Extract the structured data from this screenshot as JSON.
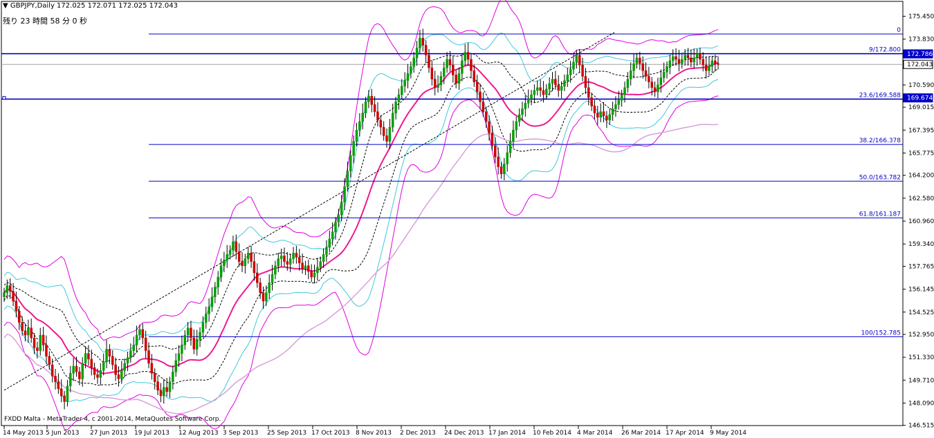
{
  "header": {
    "symbol_line": "GBPJPY,Daily  172.025 172.071 172.025 172.043",
    "countdown": "残り 23 時間 58 分 0 秒",
    "copyright": "FXDD Malta - MetaTrader 4, c 2001-2014, MetaQuotes Software Corp."
  },
  "chart_data": {
    "type": "candlestick",
    "symbol": "GBPJPY",
    "timeframe": "Daily",
    "last_bar": {
      "open": 172.025,
      "high": 172.071,
      "low": 172.025,
      "close": 172.043
    },
    "ylim": [
      146.5,
      176.5
    ],
    "y_ticks": [
      "175.450",
      "173.830",
      "172.786",
      "172.043",
      "170.590",
      "169.674",
      "169.015",
      "167.395",
      "165.775",
      "164.200",
      "162.580",
      "160.960",
      "159.340",
      "157.765",
      "156.145",
      "154.525",
      "152.950",
      "151.330",
      "149.710",
      "148.090",
      "146.515"
    ],
    "price_marks": [
      {
        "label": "172.786",
        "value": 172.786,
        "bg": "#0000c8",
        "fg": "#ffffff"
      },
      {
        "label": "172.043",
        "value": 172.043,
        "bg": "#ffffff",
        "fg": "#000000"
      },
      {
        "label": "169.674",
        "value": 169.674,
        "bg": "#0000c8",
        "fg": "#ffffff"
      }
    ],
    "x_labels": [
      "14 May 2013",
      "5 Jun 2013",
      "27 Jun 2013",
      "19 Jul 2013",
      "12 Aug 2013",
      "3 Sep 2013",
      "25 Sep 2013",
      "17 Oct 2013",
      "8 Nov 2013",
      "2 Dec 2013",
      "24 Dec 2013",
      "17 Jan 2014",
      "10 Feb 2014",
      "4 Mar 2014",
      "26 Mar 2014",
      "17 Apr 2014",
      "9 May 2014"
    ],
    "fibonacci_levels": [
      {
        "label": "0",
        "value": 174.2
      },
      {
        "label": "9/172.800",
        "value": 172.8
      },
      {
        "label": "23.6/169.588",
        "value": 169.588
      },
      {
        "label": "38.2/166.378",
        "value": 166.378
      },
      {
        "label": "50.0/163.782",
        "value": 163.782
      },
      {
        "label": "61.8/161.187",
        "value": 161.187
      },
      {
        "label": "100/152.785",
        "value": 152.785
      }
    ],
    "close_series": [
      155.9,
      156.4,
      156.0,
      155.3,
      154.6,
      153.8,
      153.2,
      152.9,
      153.4,
      152.7,
      152.0,
      151.8,
      152.9,
      152.2,
      151.4,
      150.8,
      150.0,
      149.6,
      149.1,
      148.6,
      148.2,
      149.3,
      150.2,
      150.7,
      150.3,
      149.8,
      150.9,
      151.6,
      151.2,
      150.6,
      150.1,
      149.9,
      150.4,
      151.0,
      151.9,
      151.4,
      150.8,
      150.1,
      149.8,
      150.4,
      150.9,
      151.3,
      151.8,
      152.2,
      152.9,
      153.3,
      152.7,
      151.8,
      150.9,
      150.2,
      149.6,
      149.0,
      148.6,
      149.2,
      148.9,
      149.6,
      150.3,
      151.1,
      151.6,
      152.2,
      152.9,
      153.4,
      152.7,
      151.9,
      152.6,
      153.1,
      153.8,
      154.4,
      154.9,
      155.6,
      156.3,
      157.0,
      157.8,
      158.2,
      158.6,
      158.9,
      159.5,
      158.8,
      158.1,
      157.8,
      158.3,
      158.7,
      158.1,
      157.3,
      156.6,
      155.9,
      155.3,
      155.9,
      156.6,
      157.2,
      157.8,
      158.3,
      158.5,
      158.1,
      157.9,
      158.3,
      158.7,
      158.4,
      158.0,
      157.6,
      157.8,
      157.4,
      157.0,
      157.3,
      157.7,
      158.1,
      158.6,
      159.1,
      159.7,
      160.2,
      160.9,
      161.4,
      162.3,
      163.4,
      164.5,
      165.6,
      166.6,
      167.4,
      168.0,
      168.6,
      169.4,
      169.8,
      169.2,
      168.7,
      168.1,
      167.6,
      167.0,
      166.6,
      167.6,
      168.6,
      169.4,
      169.9,
      170.5,
      170.9,
      171.4,
      171.9,
      172.5,
      173.2,
      173.9,
      173.4,
      172.7,
      171.8,
      171.0,
      170.4,
      170.6,
      171.2,
      171.8,
      172.4,
      172.0,
      171.3,
      170.7,
      171.4,
      172.3,
      172.9,
      172.4,
      171.6,
      170.8,
      170.1,
      169.4,
      168.7,
      168.0,
      167.2,
      166.3,
      165.5,
      164.8,
      164.3,
      165.0,
      165.8,
      166.6,
      167.4,
      168.0,
      168.5,
      168.9,
      169.3,
      169.6,
      169.9,
      170.2,
      170.4,
      170.2,
      169.9,
      170.3,
      170.7,
      171.0,
      170.6,
      170.2,
      170.5,
      170.9,
      171.3,
      171.7,
      172.2,
      172.7,
      172.0,
      171.2,
      170.4,
      169.7,
      169.1,
      168.6,
      168.3,
      168.7,
      168.4,
      168.1,
      168.5,
      168.9,
      169.2,
      169.5,
      169.9,
      170.4,
      171.0,
      171.6,
      172.1,
      172.5,
      172.1,
      171.6,
      171.2,
      170.8,
      170.4,
      170.1,
      170.6,
      171.1,
      171.5,
      171.9,
      172.3,
      172.6,
      172.4,
      172.1,
      172.4,
      172.7,
      172.5,
      172.2,
      172.5,
      172.8,
      172.4,
      172.0,
      171.6,
      171.9,
      172.3,
      172.1,
      172.04
    ]
  }
}
